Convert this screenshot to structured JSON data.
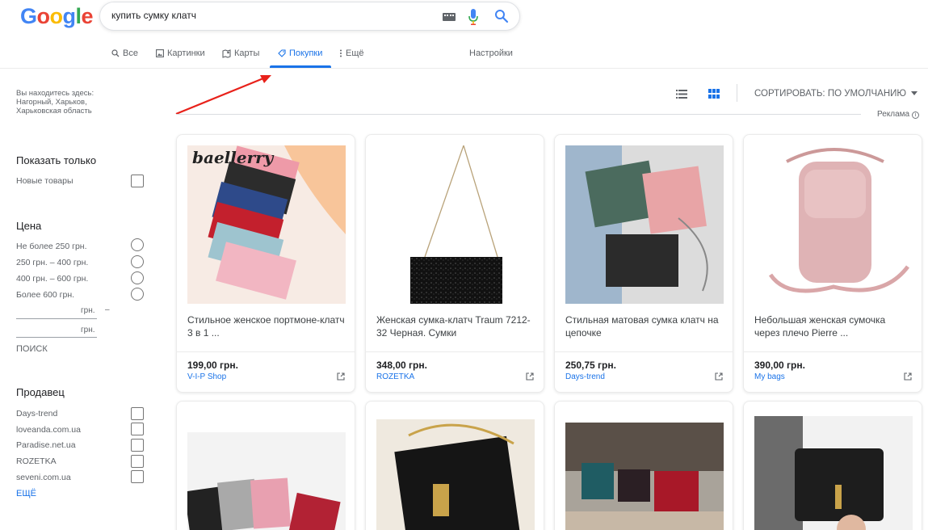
{
  "search": {
    "query": "купить сумку клатч"
  },
  "tabs": [
    {
      "label": "Все",
      "icon": "search-icon"
    },
    {
      "label": "Картинки",
      "icon": "image-icon"
    },
    {
      "label": "Карты",
      "icon": "map-icon"
    },
    {
      "label": "Покупки",
      "icon": "tag-icon",
      "active": true
    },
    {
      "label": "Ещё",
      "icon": "more-vert-icon"
    }
  ],
  "settings_label": "Настройки",
  "sidebar": {
    "location": "Вы находитесь здесь: Нагорный, Харьков, Харьковская область",
    "show_only": {
      "title": "Показать только",
      "options": [
        "Новые товары"
      ]
    },
    "price": {
      "title": "Цена",
      "options": [
        "Не более 250 грн.",
        "250 грн. – 400 грн.",
        "400 грн. – 600 грн.",
        "Более 600 грн."
      ],
      "currency": "грн.",
      "dash": "–",
      "search_label": "ПОИСК"
    },
    "seller": {
      "title": "Продавец",
      "options": [
        "Days-trend",
        "loveanda.com.ua",
        "Paradise.net.ua",
        "ROZETKA",
        "seveni.com.ua"
      ],
      "more_label": "ЕЩЁ"
    }
  },
  "toolbar": {
    "sort_label": "СОРТИРОВАТЬ: ПО УМОЛЧАНИЮ",
    "view": "grid",
    "ad_label": "Реклама",
    "info_icon": "i"
  },
  "products": [
    {
      "title": "Стильное женское портмоне-клатч 3 в 1 ...",
      "price": "199,00 грн.",
      "store": "V-I-P Shop",
      "brand_text": "baellerry"
    },
    {
      "title": "Женская сумка-клатч Traum 7212-32 Черная. Сумки",
      "price": "348,00 грн.",
      "store": "ROZETKA"
    },
    {
      "title": "Стильная матовая сумка клатч на цепочке",
      "price": "250,75 грн.",
      "store": "Days-trend"
    },
    {
      "title": "Небольшая женская сумочка через плечо Pierre ...",
      "price": "390,00 грн.",
      "store": "My bags"
    }
  ],
  "colors": {
    "accent": "#1a73e8",
    "arrow": "#e8211a"
  }
}
